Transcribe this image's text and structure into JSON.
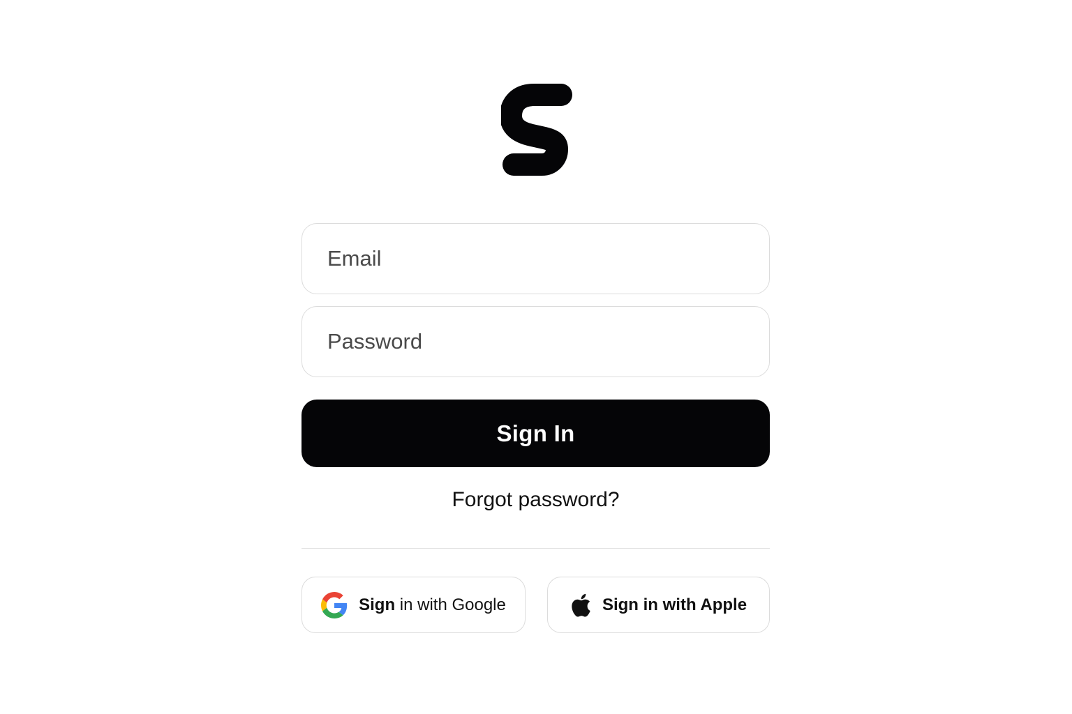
{
  "logo": {
    "icon": "s-logo-icon",
    "color": "#050507"
  },
  "form": {
    "email_placeholder": "Email",
    "password_placeholder": "Password",
    "signin_label": "Sign In",
    "forgot_label": "Forgot password?"
  },
  "social": {
    "google": {
      "label_strong": "Sign",
      "label_rest": " in with Google",
      "icon": "google-g-icon"
    },
    "apple": {
      "label": "Sign in with Apple",
      "icon": "apple-icon"
    }
  },
  "colors": {
    "primary_button": "#050507",
    "border": "#dcdcdc",
    "google_blue": "#4285F4",
    "google_red": "#EA4335",
    "google_yellow": "#FBBC05",
    "google_green": "#34A853"
  }
}
